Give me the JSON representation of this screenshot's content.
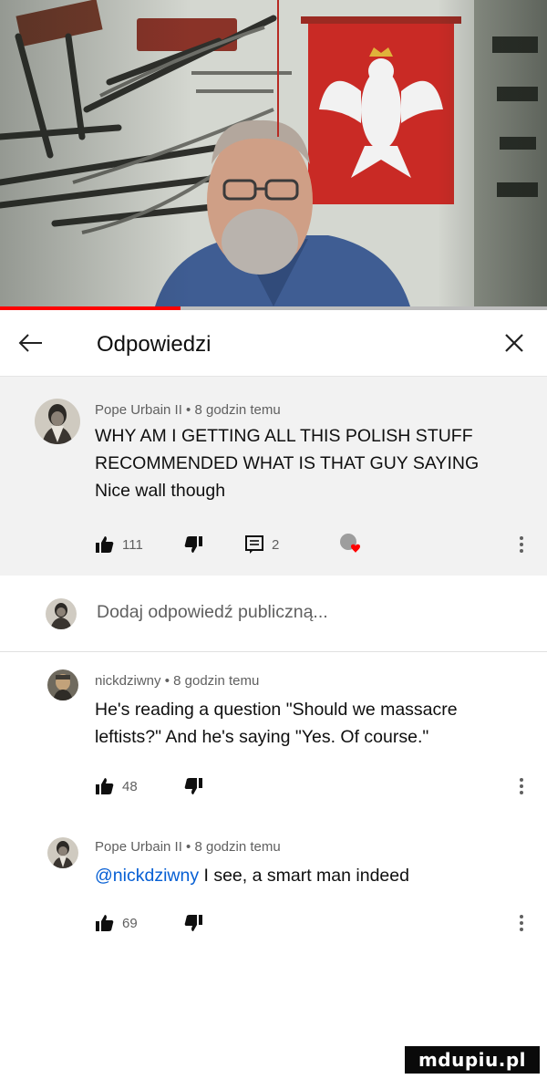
{
  "video": {
    "progress_fraction": 0.33,
    "accent_color": "#ff0000"
  },
  "header": {
    "back_icon": "arrow-left-icon",
    "title": "Odpowiedzi",
    "close_icon": "close-icon"
  },
  "parent_comment": {
    "author": "Pope Urbain II",
    "time": "8 godzin temu",
    "text_lines": [
      "WHY AM I GETTING ALL THIS POLISH STUFF",
      "RECOMMENDED WHAT IS THAT GUY SAYING",
      "Nice wall though"
    ],
    "likes": "111",
    "replies": "2",
    "icons": [
      "thumbs-up-icon",
      "thumbs-down-icon",
      "reply-icon",
      "creator-heart-icon",
      "more-vert-icon"
    ]
  },
  "add_reply": {
    "placeholder": "Dodaj odpowiedź publiczną..."
  },
  "replies": [
    {
      "author": "nickdziwny",
      "time": "8 godzin temu",
      "text_lines": [
        "He's reading a question \"Should we massacre",
        "leftists?\" And he's saying \"Yes. Of course.\""
      ],
      "likes": "48"
    },
    {
      "author": "Pope Urbain II",
      "time": "8 godzin temu",
      "mention": "@nickdziwny",
      "text_rest": " I see, a smart man indeed",
      "likes": "69"
    }
  ],
  "meta_separator": " • ",
  "watermark": "mdupiu.pl"
}
